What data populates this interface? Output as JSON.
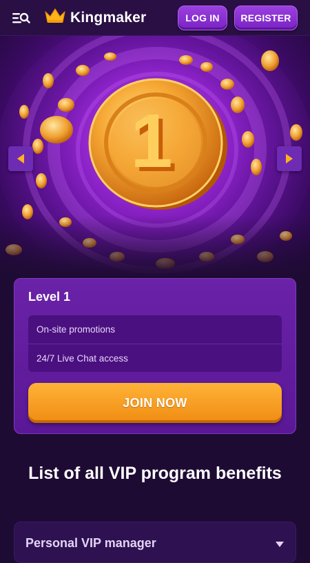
{
  "header": {
    "brand": "Kingmaker",
    "login_label": "LOG IN",
    "register_label": "REGISTER"
  },
  "hero": {
    "coin_number": "1",
    "accent_colors": {
      "purple": "#8a1fc7",
      "gold": "#f0a32a"
    }
  },
  "level": {
    "title": "Level 1",
    "perks": [
      "On-site promotions",
      "24/7 Live Chat access"
    ],
    "cta_label": "JOIN NOW"
  },
  "benefits": {
    "heading": "List of all VIP program benefits",
    "first_item": "Personal VIP manager"
  },
  "icons": [
    "menu-search-icon",
    "crown-icon",
    "chevron-left-icon",
    "chevron-right-icon",
    "chevron-down-icon"
  ]
}
